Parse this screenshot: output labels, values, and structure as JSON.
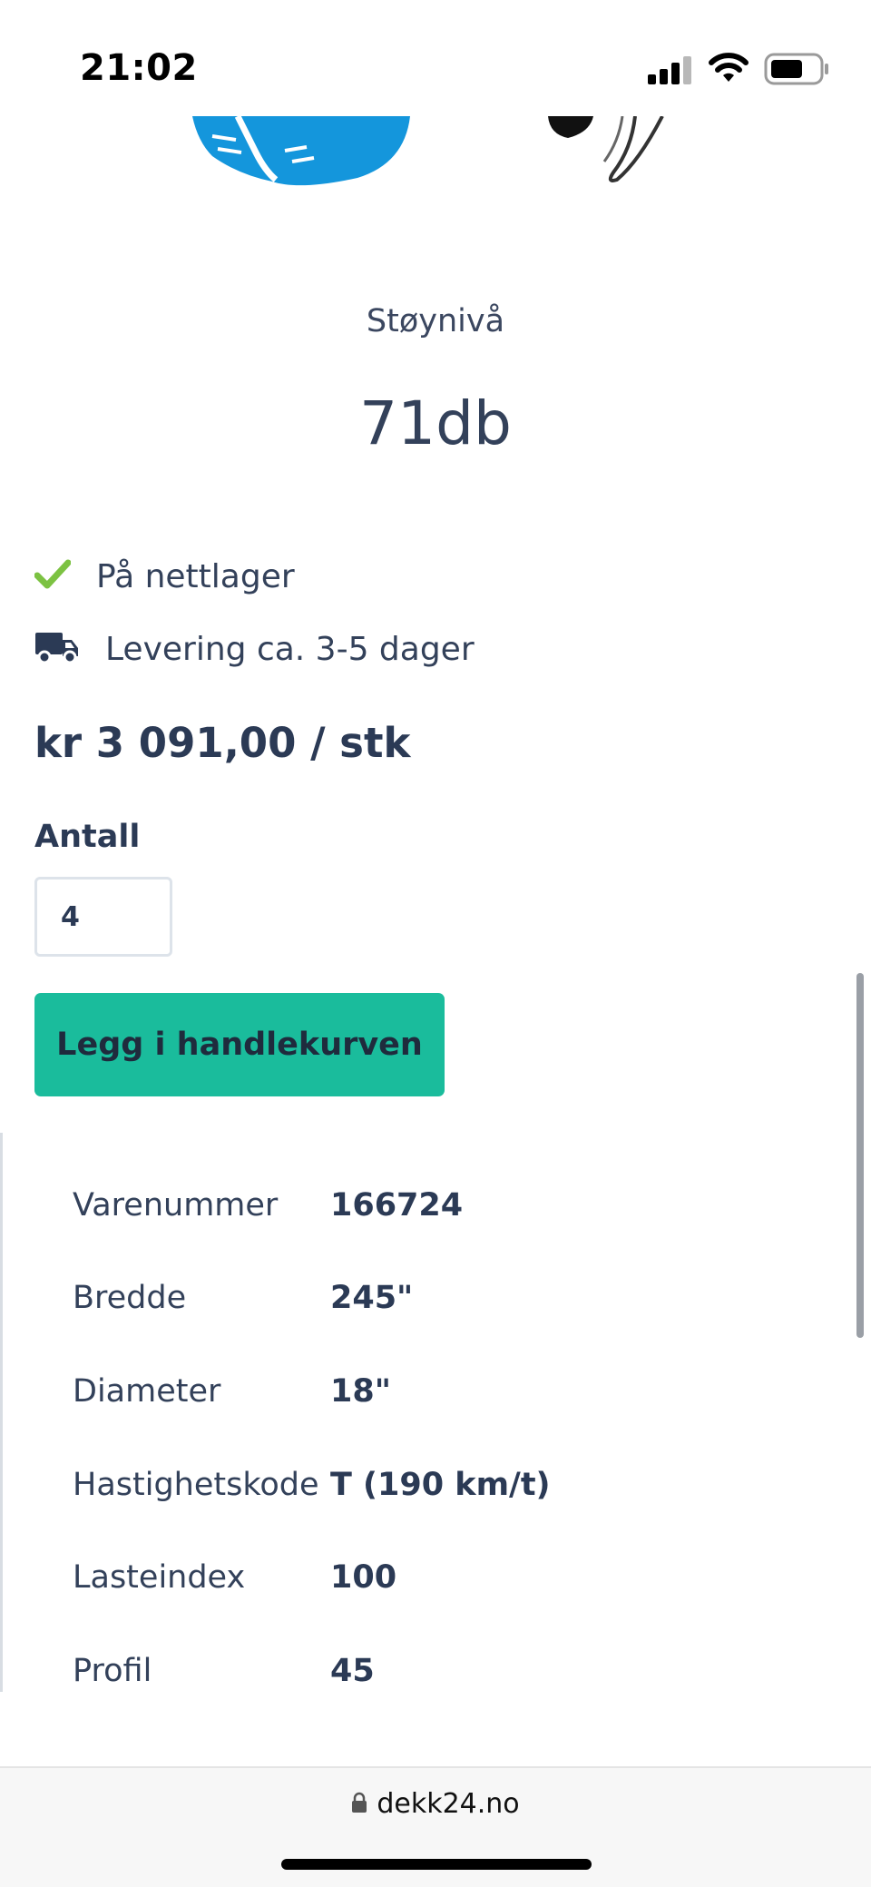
{
  "status_bar": {
    "time": "21:02",
    "icons": [
      "signal-icon",
      "wifi-icon",
      "battery-icon"
    ]
  },
  "feature": {
    "label": "Støynivå",
    "value": "71db"
  },
  "stock": {
    "icon": "check-icon",
    "icon_color": "#7cc242",
    "text": "På nettlager"
  },
  "delivery": {
    "icon": "truck-icon",
    "text": "Levering ca. 3-5 dager"
  },
  "price": "kr 3 091,00 / stk",
  "quantity": {
    "label": "Antall",
    "value": "4"
  },
  "cart_button": {
    "label": "Legg i handlekurven",
    "color": "#1abc9c"
  },
  "specs": [
    {
      "label": "Varenummer",
      "value": "166724"
    },
    {
      "label": "Bredde",
      "value": "245\""
    },
    {
      "label": "Diameter",
      "value": "18\""
    },
    {
      "label": "Hastighetskode",
      "value": "T (190 km/t)"
    },
    {
      "label": "Lasteindex",
      "value": "100"
    },
    {
      "label": "Profil",
      "value": "45"
    }
  ],
  "browser": {
    "url": "dekk24.no",
    "lock_icon": "lock-icon"
  }
}
